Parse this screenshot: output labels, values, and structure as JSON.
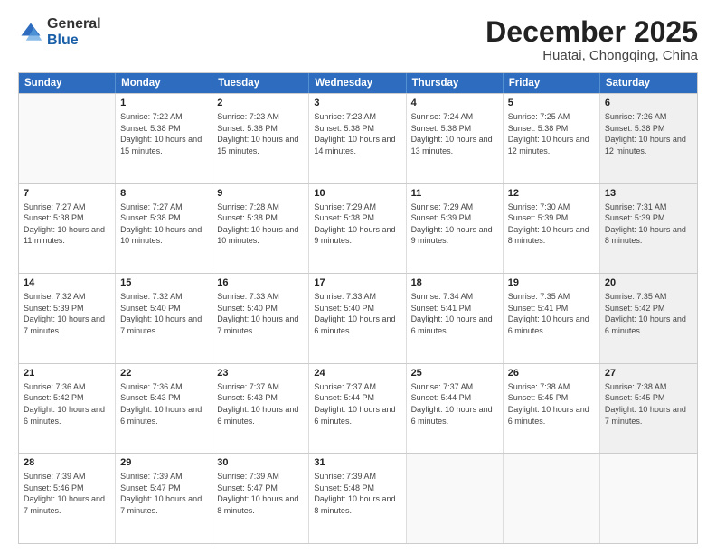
{
  "header": {
    "logo_general": "General",
    "logo_blue": "Blue",
    "title": "December 2025",
    "subtitle": "Huatai, Chongqing, China"
  },
  "days_of_week": [
    "Sunday",
    "Monday",
    "Tuesday",
    "Wednesday",
    "Thursday",
    "Friday",
    "Saturday"
  ],
  "weeks": [
    [
      {
        "day": "",
        "sunrise": "",
        "sunset": "",
        "daylight": "",
        "empty": true
      },
      {
        "day": "1",
        "sunrise": "Sunrise: 7:22 AM",
        "sunset": "Sunset: 5:38 PM",
        "daylight": "Daylight: 10 hours and 15 minutes.",
        "shaded": false
      },
      {
        "day": "2",
        "sunrise": "Sunrise: 7:23 AM",
        "sunset": "Sunset: 5:38 PM",
        "daylight": "Daylight: 10 hours and 15 minutes.",
        "shaded": false
      },
      {
        "day": "3",
        "sunrise": "Sunrise: 7:23 AM",
        "sunset": "Sunset: 5:38 PM",
        "daylight": "Daylight: 10 hours and 14 minutes.",
        "shaded": false
      },
      {
        "day": "4",
        "sunrise": "Sunrise: 7:24 AM",
        "sunset": "Sunset: 5:38 PM",
        "daylight": "Daylight: 10 hours and 13 minutes.",
        "shaded": false
      },
      {
        "day": "5",
        "sunrise": "Sunrise: 7:25 AM",
        "sunset": "Sunset: 5:38 PM",
        "daylight": "Daylight: 10 hours and 12 minutes.",
        "shaded": false
      },
      {
        "day": "6",
        "sunrise": "Sunrise: 7:26 AM",
        "sunset": "Sunset: 5:38 PM",
        "daylight": "Daylight: 10 hours and 12 minutes.",
        "shaded": true
      }
    ],
    [
      {
        "day": "7",
        "sunrise": "Sunrise: 7:27 AM",
        "sunset": "Sunset: 5:38 PM",
        "daylight": "Daylight: 10 hours and 11 minutes.",
        "shaded": false
      },
      {
        "day": "8",
        "sunrise": "Sunrise: 7:27 AM",
        "sunset": "Sunset: 5:38 PM",
        "daylight": "Daylight: 10 hours and 10 minutes.",
        "shaded": false
      },
      {
        "day": "9",
        "sunrise": "Sunrise: 7:28 AM",
        "sunset": "Sunset: 5:38 PM",
        "daylight": "Daylight: 10 hours and 10 minutes.",
        "shaded": false
      },
      {
        "day": "10",
        "sunrise": "Sunrise: 7:29 AM",
        "sunset": "Sunset: 5:38 PM",
        "daylight": "Daylight: 10 hours and 9 minutes.",
        "shaded": false
      },
      {
        "day": "11",
        "sunrise": "Sunrise: 7:29 AM",
        "sunset": "Sunset: 5:39 PM",
        "daylight": "Daylight: 10 hours and 9 minutes.",
        "shaded": false
      },
      {
        "day": "12",
        "sunrise": "Sunrise: 7:30 AM",
        "sunset": "Sunset: 5:39 PM",
        "daylight": "Daylight: 10 hours and 8 minutes.",
        "shaded": false
      },
      {
        "day": "13",
        "sunrise": "Sunrise: 7:31 AM",
        "sunset": "Sunset: 5:39 PM",
        "daylight": "Daylight: 10 hours and 8 minutes.",
        "shaded": true
      }
    ],
    [
      {
        "day": "14",
        "sunrise": "Sunrise: 7:32 AM",
        "sunset": "Sunset: 5:39 PM",
        "daylight": "Daylight: 10 hours and 7 minutes.",
        "shaded": false
      },
      {
        "day": "15",
        "sunrise": "Sunrise: 7:32 AM",
        "sunset": "Sunset: 5:40 PM",
        "daylight": "Daylight: 10 hours and 7 minutes.",
        "shaded": false
      },
      {
        "day": "16",
        "sunrise": "Sunrise: 7:33 AM",
        "sunset": "Sunset: 5:40 PM",
        "daylight": "Daylight: 10 hours and 7 minutes.",
        "shaded": false
      },
      {
        "day": "17",
        "sunrise": "Sunrise: 7:33 AM",
        "sunset": "Sunset: 5:40 PM",
        "daylight": "Daylight: 10 hours and 6 minutes.",
        "shaded": false
      },
      {
        "day": "18",
        "sunrise": "Sunrise: 7:34 AM",
        "sunset": "Sunset: 5:41 PM",
        "daylight": "Daylight: 10 hours and 6 minutes.",
        "shaded": false
      },
      {
        "day": "19",
        "sunrise": "Sunrise: 7:35 AM",
        "sunset": "Sunset: 5:41 PM",
        "daylight": "Daylight: 10 hours and 6 minutes.",
        "shaded": false
      },
      {
        "day": "20",
        "sunrise": "Sunrise: 7:35 AM",
        "sunset": "Sunset: 5:42 PM",
        "daylight": "Daylight: 10 hours and 6 minutes.",
        "shaded": true
      }
    ],
    [
      {
        "day": "21",
        "sunrise": "Sunrise: 7:36 AM",
        "sunset": "Sunset: 5:42 PM",
        "daylight": "Daylight: 10 hours and 6 minutes.",
        "shaded": false
      },
      {
        "day": "22",
        "sunrise": "Sunrise: 7:36 AM",
        "sunset": "Sunset: 5:43 PM",
        "daylight": "Daylight: 10 hours and 6 minutes.",
        "shaded": false
      },
      {
        "day": "23",
        "sunrise": "Sunrise: 7:37 AM",
        "sunset": "Sunset: 5:43 PM",
        "daylight": "Daylight: 10 hours and 6 minutes.",
        "shaded": false
      },
      {
        "day": "24",
        "sunrise": "Sunrise: 7:37 AM",
        "sunset": "Sunset: 5:44 PM",
        "daylight": "Daylight: 10 hours and 6 minutes.",
        "shaded": false
      },
      {
        "day": "25",
        "sunrise": "Sunrise: 7:37 AM",
        "sunset": "Sunset: 5:44 PM",
        "daylight": "Daylight: 10 hours and 6 minutes.",
        "shaded": false
      },
      {
        "day": "26",
        "sunrise": "Sunrise: 7:38 AM",
        "sunset": "Sunset: 5:45 PM",
        "daylight": "Daylight: 10 hours and 6 minutes.",
        "shaded": false
      },
      {
        "day": "27",
        "sunrise": "Sunrise: 7:38 AM",
        "sunset": "Sunset: 5:45 PM",
        "daylight": "Daylight: 10 hours and 7 minutes.",
        "shaded": true
      }
    ],
    [
      {
        "day": "28",
        "sunrise": "Sunrise: 7:39 AM",
        "sunset": "Sunset: 5:46 PM",
        "daylight": "Daylight: 10 hours and 7 minutes.",
        "shaded": false
      },
      {
        "day": "29",
        "sunrise": "Sunrise: 7:39 AM",
        "sunset": "Sunset: 5:47 PM",
        "daylight": "Daylight: 10 hours and 7 minutes.",
        "shaded": false
      },
      {
        "day": "30",
        "sunrise": "Sunrise: 7:39 AM",
        "sunset": "Sunset: 5:47 PM",
        "daylight": "Daylight: 10 hours and 8 minutes.",
        "shaded": false
      },
      {
        "day": "31",
        "sunrise": "Sunrise: 7:39 AM",
        "sunset": "Sunset: 5:48 PM",
        "daylight": "Daylight: 10 hours and 8 minutes.",
        "shaded": false
      },
      {
        "day": "",
        "sunrise": "",
        "sunset": "",
        "daylight": "",
        "empty": true
      },
      {
        "day": "",
        "sunrise": "",
        "sunset": "",
        "daylight": "",
        "empty": true
      },
      {
        "day": "",
        "sunrise": "",
        "sunset": "",
        "daylight": "",
        "empty": true,
        "shaded": true
      }
    ]
  ]
}
